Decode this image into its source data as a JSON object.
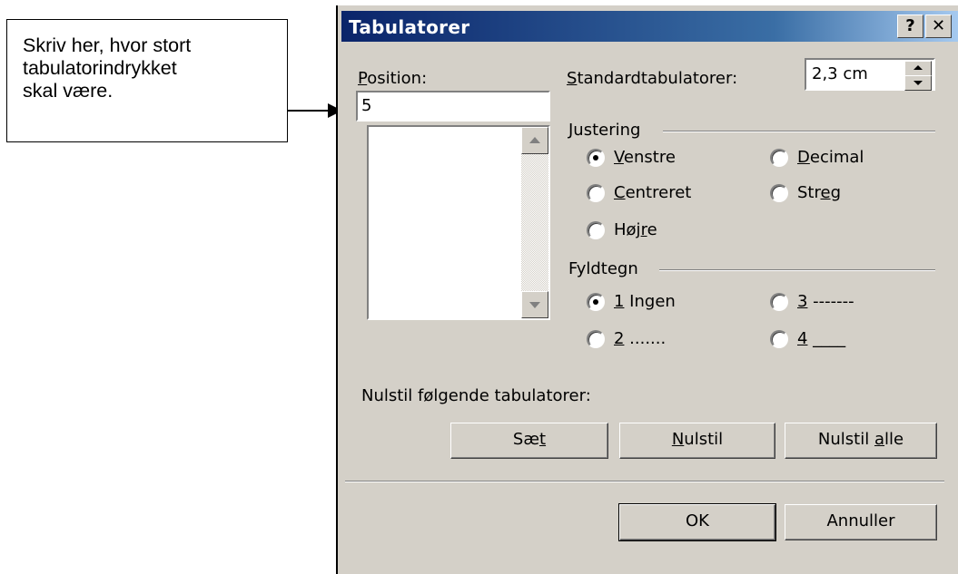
{
  "callout": {
    "lines": [
      "Skriv her, hvor stort",
      "tabulatorindrykket",
      "skal være."
    ]
  },
  "dialog": {
    "title": "Tabulatorer",
    "help_button": "?",
    "close_button": "✕",
    "position_label": "Position:",
    "position_value": "5",
    "standard_label": "Standardtabulatorer:",
    "standard_value": "2,3 cm",
    "justering": {
      "label": "Justering",
      "options": [
        "Venstre",
        "Decimal",
        "Centreret",
        "Streg",
        "Højre"
      ],
      "selected": "Venstre"
    },
    "fyldtegn": {
      "label": "Fyldtegn",
      "options": [
        "1 Ingen",
        "3 -------",
        "2 .......",
        "4 ____"
      ],
      "selected": "1 Ingen"
    },
    "clear_label": "Nulstil følgende tabulatorer:",
    "buttons": {
      "set": "Sæt",
      "clear": "Nulstil",
      "clear_all": "Nulstil alle",
      "ok": "OK",
      "cancel": "Annuller"
    }
  }
}
